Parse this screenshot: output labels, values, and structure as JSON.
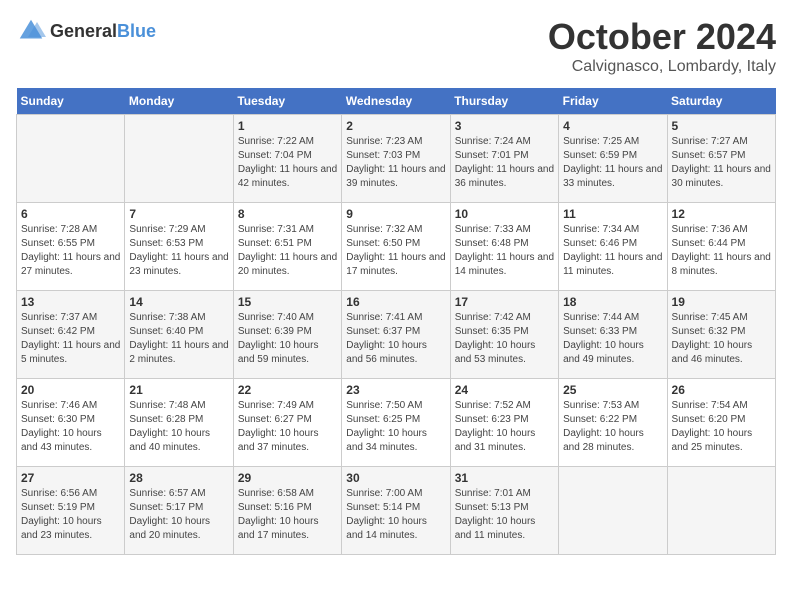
{
  "header": {
    "logo_general": "General",
    "logo_blue": "Blue",
    "month": "October 2024",
    "location": "Calvignasco, Lombardy, Italy"
  },
  "days_of_week": [
    "Sunday",
    "Monday",
    "Tuesday",
    "Wednesday",
    "Thursday",
    "Friday",
    "Saturday"
  ],
  "weeks": [
    [
      {
        "day": "",
        "info": ""
      },
      {
        "day": "",
        "info": ""
      },
      {
        "day": "1",
        "info": "Sunrise: 7:22 AM\nSunset: 7:04 PM\nDaylight: 11 hours and 42 minutes."
      },
      {
        "day": "2",
        "info": "Sunrise: 7:23 AM\nSunset: 7:03 PM\nDaylight: 11 hours and 39 minutes."
      },
      {
        "day": "3",
        "info": "Sunrise: 7:24 AM\nSunset: 7:01 PM\nDaylight: 11 hours and 36 minutes."
      },
      {
        "day": "4",
        "info": "Sunrise: 7:25 AM\nSunset: 6:59 PM\nDaylight: 11 hours and 33 minutes."
      },
      {
        "day": "5",
        "info": "Sunrise: 7:27 AM\nSunset: 6:57 PM\nDaylight: 11 hours and 30 minutes."
      }
    ],
    [
      {
        "day": "6",
        "info": "Sunrise: 7:28 AM\nSunset: 6:55 PM\nDaylight: 11 hours and 27 minutes."
      },
      {
        "day": "7",
        "info": "Sunrise: 7:29 AM\nSunset: 6:53 PM\nDaylight: 11 hours and 23 minutes."
      },
      {
        "day": "8",
        "info": "Sunrise: 7:31 AM\nSunset: 6:51 PM\nDaylight: 11 hours and 20 minutes."
      },
      {
        "day": "9",
        "info": "Sunrise: 7:32 AM\nSunset: 6:50 PM\nDaylight: 11 hours and 17 minutes."
      },
      {
        "day": "10",
        "info": "Sunrise: 7:33 AM\nSunset: 6:48 PM\nDaylight: 11 hours and 14 minutes."
      },
      {
        "day": "11",
        "info": "Sunrise: 7:34 AM\nSunset: 6:46 PM\nDaylight: 11 hours and 11 minutes."
      },
      {
        "day": "12",
        "info": "Sunrise: 7:36 AM\nSunset: 6:44 PM\nDaylight: 11 hours and 8 minutes."
      }
    ],
    [
      {
        "day": "13",
        "info": "Sunrise: 7:37 AM\nSunset: 6:42 PM\nDaylight: 11 hours and 5 minutes."
      },
      {
        "day": "14",
        "info": "Sunrise: 7:38 AM\nSunset: 6:40 PM\nDaylight: 11 hours and 2 minutes."
      },
      {
        "day": "15",
        "info": "Sunrise: 7:40 AM\nSunset: 6:39 PM\nDaylight: 10 hours and 59 minutes."
      },
      {
        "day": "16",
        "info": "Sunrise: 7:41 AM\nSunset: 6:37 PM\nDaylight: 10 hours and 56 minutes."
      },
      {
        "day": "17",
        "info": "Sunrise: 7:42 AM\nSunset: 6:35 PM\nDaylight: 10 hours and 53 minutes."
      },
      {
        "day": "18",
        "info": "Sunrise: 7:44 AM\nSunset: 6:33 PM\nDaylight: 10 hours and 49 minutes."
      },
      {
        "day": "19",
        "info": "Sunrise: 7:45 AM\nSunset: 6:32 PM\nDaylight: 10 hours and 46 minutes."
      }
    ],
    [
      {
        "day": "20",
        "info": "Sunrise: 7:46 AM\nSunset: 6:30 PM\nDaylight: 10 hours and 43 minutes."
      },
      {
        "day": "21",
        "info": "Sunrise: 7:48 AM\nSunset: 6:28 PM\nDaylight: 10 hours and 40 minutes."
      },
      {
        "day": "22",
        "info": "Sunrise: 7:49 AM\nSunset: 6:27 PM\nDaylight: 10 hours and 37 minutes."
      },
      {
        "day": "23",
        "info": "Sunrise: 7:50 AM\nSunset: 6:25 PM\nDaylight: 10 hours and 34 minutes."
      },
      {
        "day": "24",
        "info": "Sunrise: 7:52 AM\nSunset: 6:23 PM\nDaylight: 10 hours and 31 minutes."
      },
      {
        "day": "25",
        "info": "Sunrise: 7:53 AM\nSunset: 6:22 PM\nDaylight: 10 hours and 28 minutes."
      },
      {
        "day": "26",
        "info": "Sunrise: 7:54 AM\nSunset: 6:20 PM\nDaylight: 10 hours and 25 minutes."
      }
    ],
    [
      {
        "day": "27",
        "info": "Sunrise: 6:56 AM\nSunset: 5:19 PM\nDaylight: 10 hours and 23 minutes."
      },
      {
        "day": "28",
        "info": "Sunrise: 6:57 AM\nSunset: 5:17 PM\nDaylight: 10 hours and 20 minutes."
      },
      {
        "day": "29",
        "info": "Sunrise: 6:58 AM\nSunset: 5:16 PM\nDaylight: 10 hours and 17 minutes."
      },
      {
        "day": "30",
        "info": "Sunrise: 7:00 AM\nSunset: 5:14 PM\nDaylight: 10 hours and 14 minutes."
      },
      {
        "day": "31",
        "info": "Sunrise: 7:01 AM\nSunset: 5:13 PM\nDaylight: 10 hours and 11 minutes."
      },
      {
        "day": "",
        "info": ""
      },
      {
        "day": "",
        "info": ""
      }
    ]
  ]
}
